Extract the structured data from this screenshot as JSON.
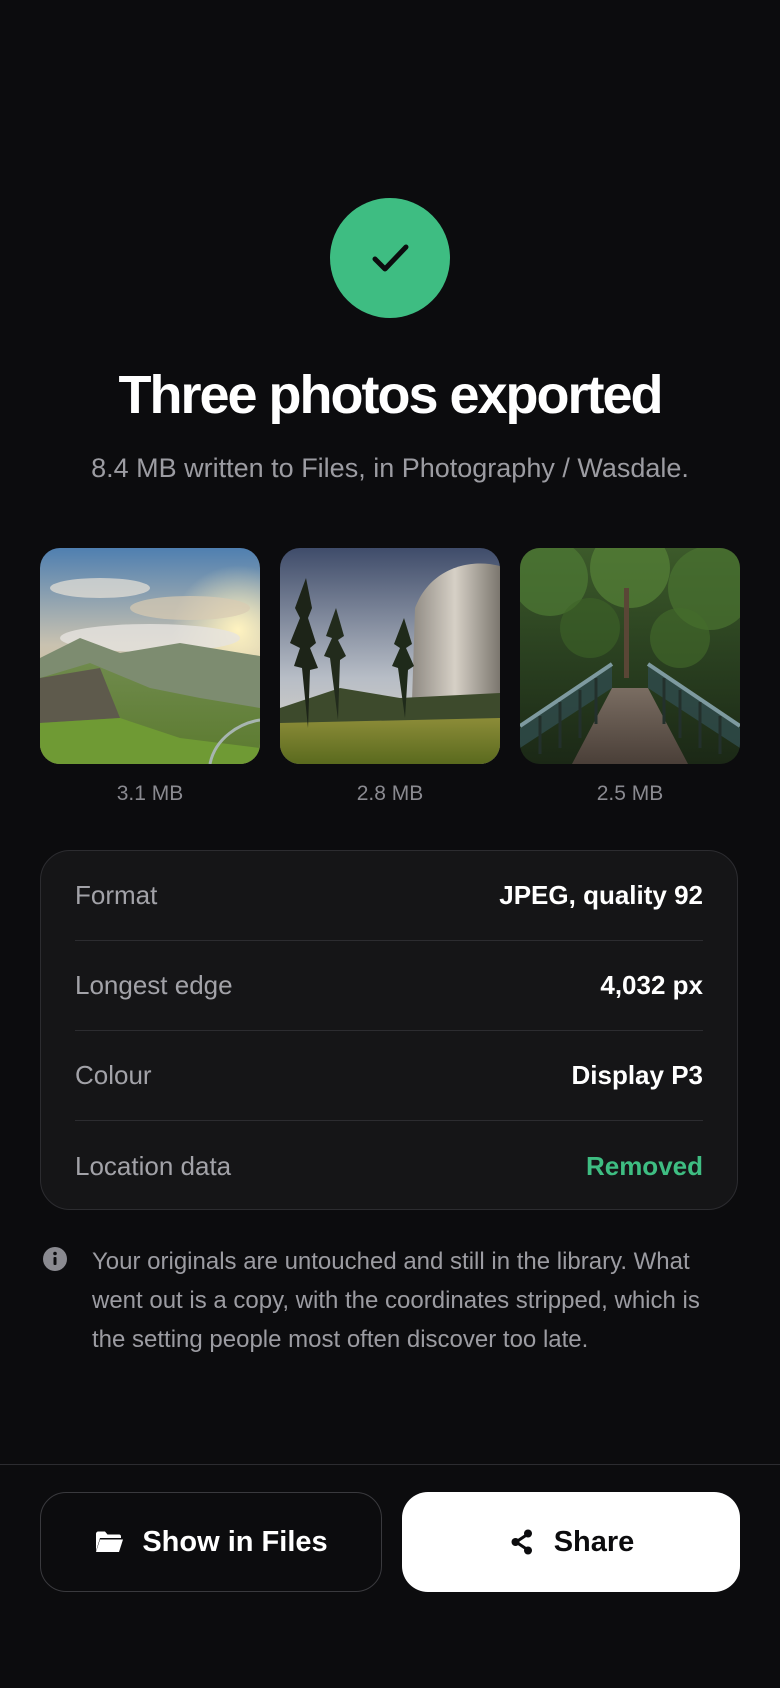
{
  "header": {
    "title": "Three photos exported",
    "subtitle": "8.4 MB written to Files, in Photography / Wasdale."
  },
  "photos": [
    {
      "size": "3.1 MB",
      "icon": "landscape-photo"
    },
    {
      "size": "2.8 MB",
      "icon": "valley-photo"
    },
    {
      "size": "2.5 MB",
      "icon": "bridge-photo"
    }
  ],
  "details": [
    {
      "label": "Format",
      "value": "JPEG, quality 92"
    },
    {
      "label": "Longest edge",
      "value": "4,032 px"
    },
    {
      "label": "Colour",
      "value": "Display P3"
    },
    {
      "label": "Location data",
      "value": "Removed"
    }
  ],
  "note": "Your originals are untouched and still in the library. What went out is a copy, with the coordinates stripped, which is the setting people most often discover too late.",
  "actions": {
    "show_in_files": "Show in Files",
    "share": "Share"
  },
  "colors": {
    "accent": "#3ebd82",
    "background": "#0c0c0e"
  }
}
